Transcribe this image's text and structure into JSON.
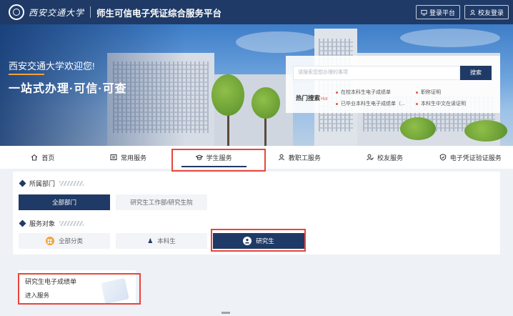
{
  "header": {
    "logo_text": "西安交通大学",
    "platform_title": "师生可信电子凭证综合服务平台",
    "login_label": "登录平台",
    "alumni_login_label": "校友登录"
  },
  "banner": {
    "welcome": "西安交通大学欢迎您!",
    "slogan": "一站式办理·可信·可查",
    "search_placeholder": "请搜索您想办理的事项",
    "search_button": "搜索",
    "hot_label": "热门搜索",
    "hot_badge": "Hot",
    "hot_items": [
      "在校本科生电子成绩单",
      "职称证明",
      "已毕业本科生电子成绩单（...",
      "本科生中文在读证明"
    ]
  },
  "nav": {
    "items": [
      {
        "label": "首页",
        "icon": "home-icon"
      },
      {
        "label": "常用服务",
        "icon": "list-icon"
      },
      {
        "label": "学生服务",
        "icon": "graduation-cap-icon",
        "active": true
      },
      {
        "label": "教职工服务",
        "icon": "user-icon"
      },
      {
        "label": "校友服务",
        "icon": "alumni-icon"
      },
      {
        "label": "电子凭证验证服务",
        "icon": "shield-check-icon"
      }
    ]
  },
  "filters": {
    "department_label": "所属部门",
    "departments": [
      "全部部门",
      "研究生工作部/研究生院"
    ],
    "audience_label": "服务对象",
    "audiences": [
      "全部分类",
      "本科生",
      "研究生"
    ],
    "selected_department": "全部部门",
    "selected_audience": "研究生"
  },
  "results": [
    {
      "title": "研究生电子成绩单",
      "action": "进入服务"
    }
  ],
  "colors": {
    "primary": "#1f3a66",
    "highlight": "#e8453c",
    "accent": "#f2a23a"
  }
}
